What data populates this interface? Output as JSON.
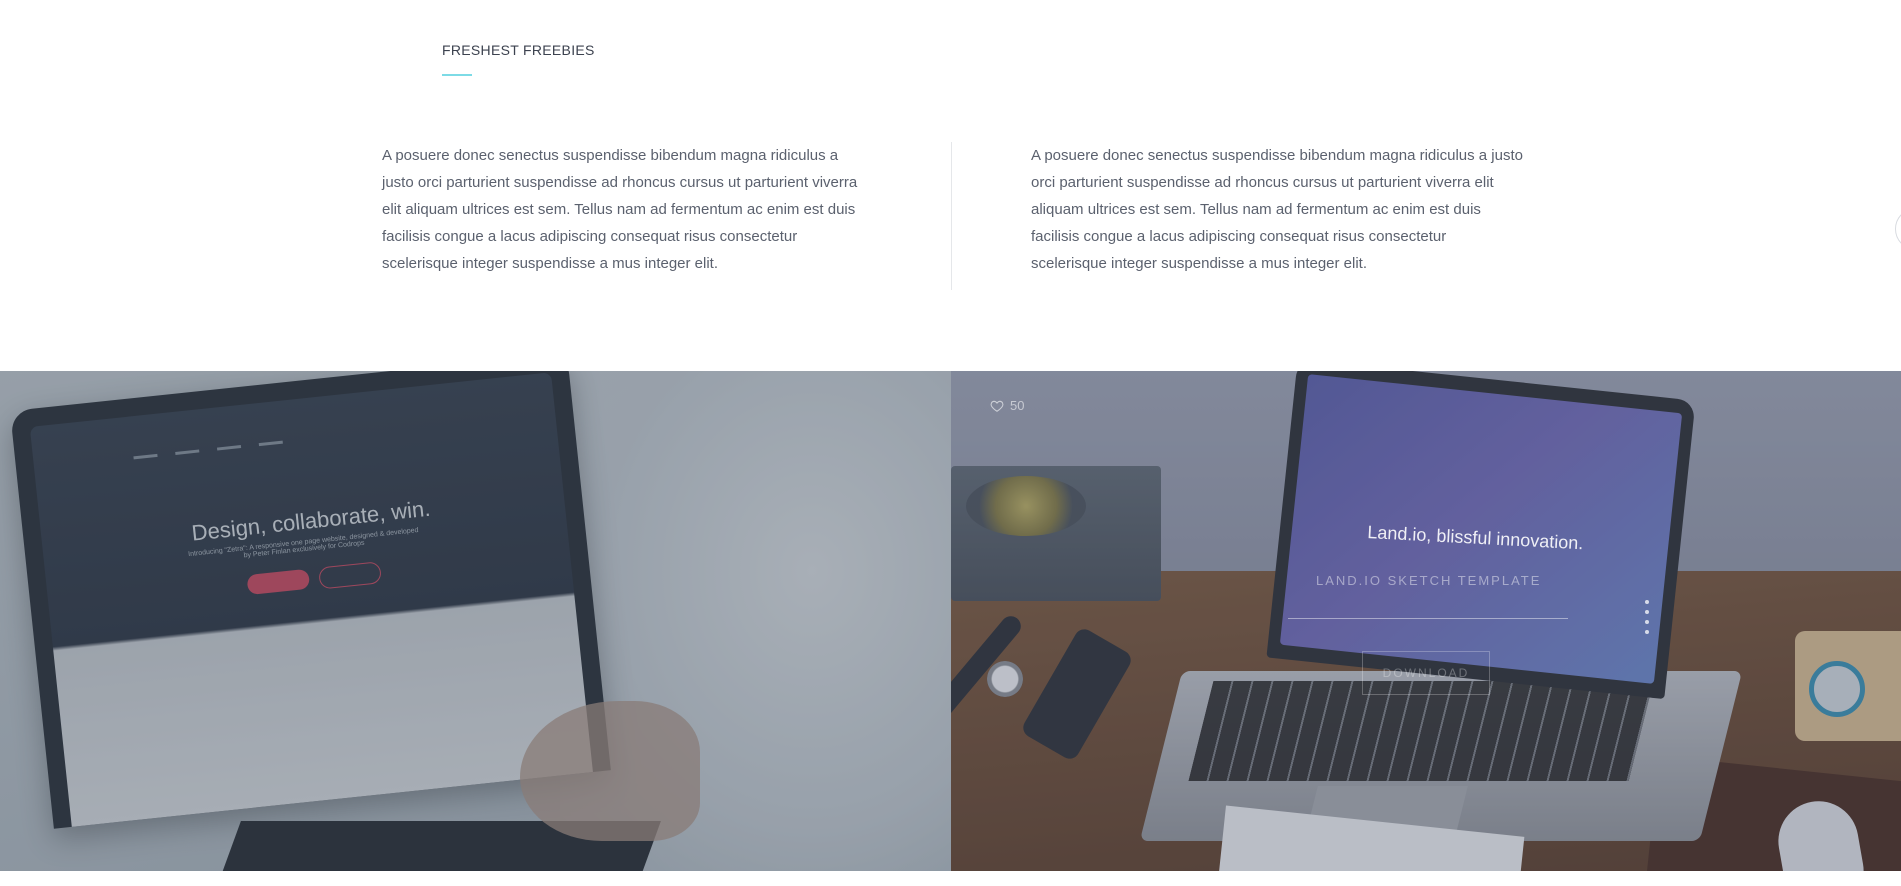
{
  "section": {
    "title": "FRESHEST FREEBIES"
  },
  "columns": [
    {
      "text": "A posuere donec senectus suspendisse bibendum magna ridiculus a justo orci parturient suspendisse ad rhoncus cursus ut parturient viverra elit aliquam ultrices est sem. Tellus nam ad fermentum ac enim est duis facilisis congue a lacus adipiscing consequat risus consectetur scelerisque integer suspendisse a mus integer elit."
    },
    {
      "text": "A posuere donec senectus suspendisse bibendum magna ridiculus a justo orci parturient suspendisse ad rhoncus cursus ut parturient viverra elit aliquam ultrices est sem. Tellus nam ad fermentum ac enim est duis facilisis congue a lacus adipiscing consequat risus consectetur scelerisque integer suspendisse a mus integer elit."
    }
  ],
  "gallery": {
    "left_tile": {
      "screen_headline": "Design, collaborate, win.",
      "screen_subtitle": "Introducing \"Zetra\": A responsive one page website, designed & developed by Peter Finlan exclusively for Codrops"
    },
    "right_tile": {
      "likes": "50",
      "screen_headline": "Land.io, blissful innovation.",
      "title": "LAND.IO SKETCH TEMPLATE",
      "download_label": "DOWNLOAD"
    }
  },
  "icons": {
    "heart": "heart-icon"
  },
  "colors": {
    "accent": "#7ddbe6",
    "text": "#5b616e"
  }
}
